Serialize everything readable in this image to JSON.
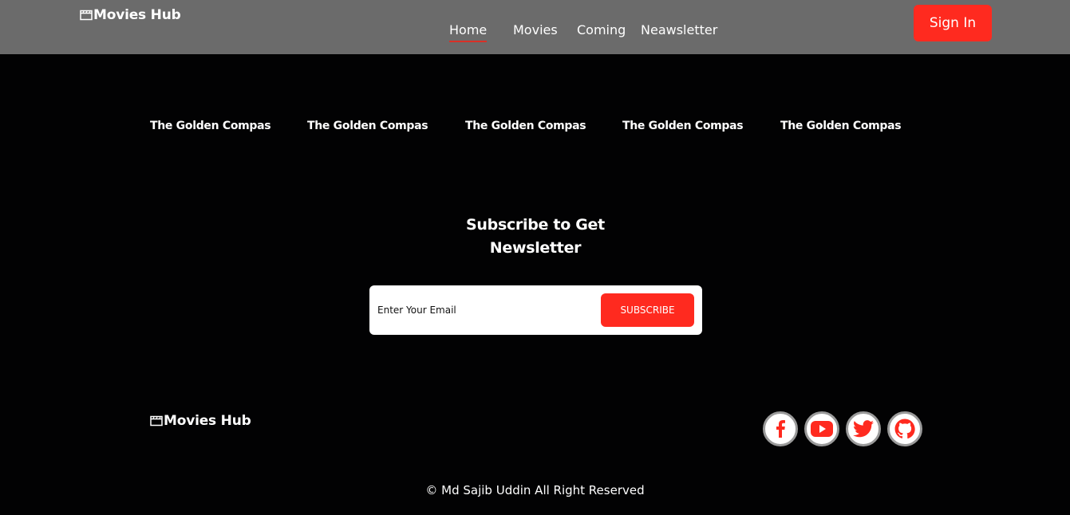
{
  "header": {
    "brand": "Movies Hub",
    "nav": [
      "Home",
      "Movies",
      "Coming",
      "Neawsletter"
    ],
    "active_nav": "Home",
    "signin_label": "Sign In"
  },
  "titles": [
    "The Golden Compas",
    "The Golden Compas",
    "The Golden Compas",
    "The Golden Compas",
    "The Golden Compas"
  ],
  "subscribe": {
    "heading_line1": "Subscribe to Get",
    "heading_line2": "Newsletter",
    "placeholder": "Enter Your Email",
    "button_label": "SUBSCRIBE"
  },
  "footer": {
    "brand": "Movies Hub",
    "socials": [
      "facebook-icon",
      "youtube-icon",
      "twitter-icon",
      "github-icon"
    ],
    "copyright": "© Md Sajib Uddin All Right Reserved"
  },
  "colors": {
    "accent": "#ff2a1f",
    "header_bg": "#6b6b6b",
    "page_bg": "#020203"
  }
}
